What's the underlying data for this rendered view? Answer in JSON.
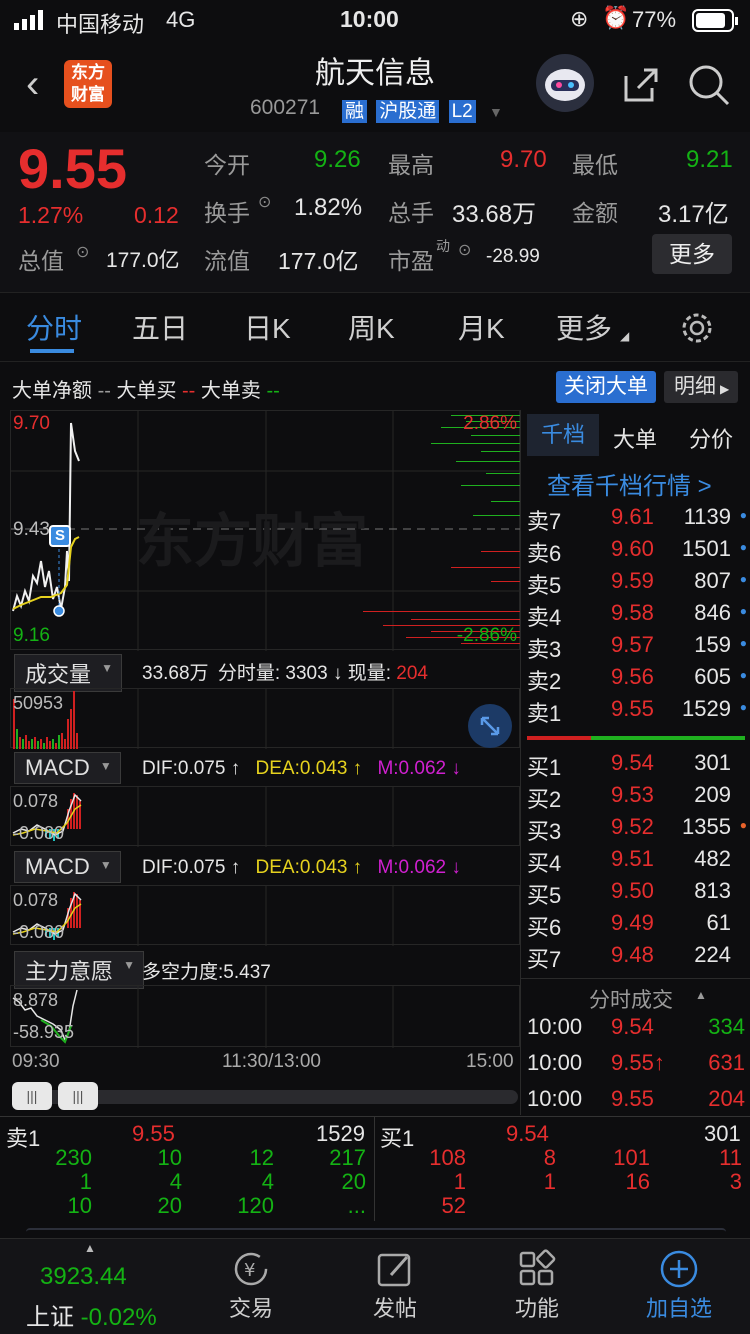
{
  "status": {
    "carrier": "中国移动",
    "network": "4G",
    "time": "10:00",
    "battery": "77%"
  },
  "header": {
    "title": "航天信息",
    "code": "600271",
    "badges": [
      "融",
      "沪股通",
      "L2"
    ],
    "logo_line1": "东方",
    "logo_line2": "财富"
  },
  "quote": {
    "price": "9.55",
    "change_pct": "1.27%",
    "change": "0.12",
    "open_label": "今开",
    "open": "9.26",
    "high_label": "最高",
    "high": "9.70",
    "low_label": "最低",
    "low": "9.21",
    "turnover_label": "换手",
    "turnover": "1.82%",
    "volume_label": "总手",
    "volume": "33.68万",
    "amount_label": "金额",
    "amount": "3.17亿",
    "mktcap_label": "总值",
    "mktcap": "177.0亿",
    "float_label": "流值",
    "float": "177.0亿",
    "pe_label": "市盈",
    "pe_sup": "动",
    "pe": "-28.99",
    "more_button": "更多"
  },
  "tabs": [
    "分时",
    "五日",
    "日K",
    "周K",
    "月K",
    "更多"
  ],
  "chart": {
    "legend_net": "大单净额",
    "legend_buy": "大单买",
    "legend_sell": "大单卖",
    "dash": "--",
    "close_big_button": "关闭大单",
    "detail_button": "明细",
    "price_high": "9.70",
    "price_mid": "9.43",
    "price_low": "9.16",
    "pct_high": "2.86%",
    "pct_low": "-2.86%",
    "s_marker": "S",
    "watermark": "东方财富",
    "volume_selector": "成交量",
    "volume_total": "33.68万",
    "tick_label": "分时量:",
    "tick_value": "3303",
    "down_arrow": "↓",
    "cur_label": "现量:",
    "cur_value": "204",
    "volume_max": "50953",
    "macd_selector": "MACD",
    "dif": "DIF:0.075 ↑",
    "dea": "DEA:0.043 ↑",
    "m": "M:0.062 ↓",
    "macd_top": "0.078",
    "macd_bot": "-0.080",
    "force_selector": "主力意愿",
    "force_text": "多空力度:5.437",
    "force_top": "8.878",
    "force_bot": "-58.935",
    "time_start": "09:30",
    "time_mid": "11:30/13:00",
    "time_end": "15:00"
  },
  "orderbook": {
    "tabs": [
      "千档",
      "大单",
      "分价"
    ],
    "link": "查看千档行情 >",
    "asks": [
      {
        "label": "卖7",
        "price": "9.61",
        "vol": "1139"
      },
      {
        "label": "卖6",
        "price": "9.60",
        "vol": "1501"
      },
      {
        "label": "卖5",
        "price": "9.59",
        "vol": "807"
      },
      {
        "label": "卖4",
        "price": "9.58",
        "vol": "846"
      },
      {
        "label": "卖3",
        "price": "9.57",
        "vol": "159"
      },
      {
        "label": "卖2",
        "price": "9.56",
        "vol": "605"
      },
      {
        "label": "卖1",
        "price": "9.55",
        "vol": "1529"
      }
    ],
    "bids": [
      {
        "label": "买1",
        "price": "9.54",
        "vol": "301"
      },
      {
        "label": "买2",
        "price": "9.53",
        "vol": "209"
      },
      {
        "label": "买3",
        "price": "9.52",
        "vol": "1355"
      },
      {
        "label": "买4",
        "price": "9.51",
        "vol": "482"
      },
      {
        "label": "买5",
        "price": "9.50",
        "vol": "813"
      },
      {
        "label": "买6",
        "price": "9.49",
        "vol": "61"
      },
      {
        "label": "买7",
        "price": "9.48",
        "vol": "224"
      }
    ],
    "trades_title": "分时成交",
    "trades": [
      {
        "time": "10:00",
        "price": "9.54",
        "vol": "334"
      },
      {
        "time": "10:00",
        "price": "9.55↑",
        "vol": "631"
      },
      {
        "time": "10:00",
        "price": "9.55",
        "vol": "204"
      }
    ]
  },
  "queue": {
    "sell_label": "卖1",
    "sell_price": "9.55",
    "sell_vol": "1529",
    "buy_label": "买1",
    "buy_price": "9.54",
    "buy_vol": "301",
    "sell_rows": [
      [
        "230",
        "10",
        "12",
        "217"
      ],
      [
        "1",
        "4",
        "4",
        "20"
      ],
      [
        "10",
        "20",
        "120",
        "..."
      ]
    ],
    "buy_rows": [
      [
        "108",
        "8",
        "101",
        "11"
      ],
      [
        "1",
        "1",
        "16",
        "3"
      ],
      [
        "52",
        "",
        "",
        ""
      ]
    ]
  },
  "nav": {
    "index_value": "3923.44",
    "index_name": "上证",
    "index_change": "-0.02%",
    "items": [
      "交易",
      "发帖",
      "功能",
      "加自选"
    ]
  }
}
